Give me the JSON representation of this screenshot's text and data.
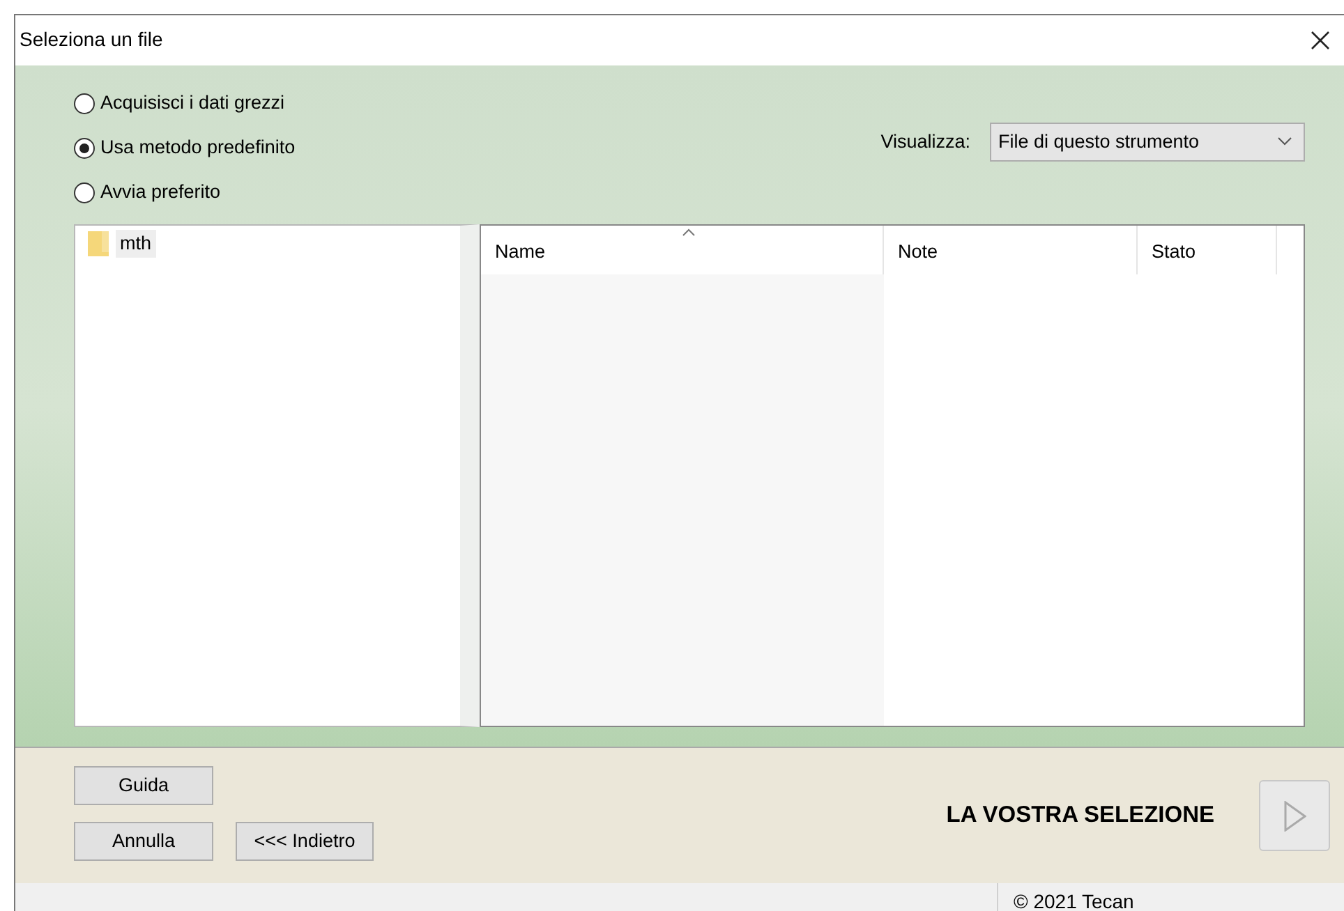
{
  "window": {
    "title": "Seleziona un file"
  },
  "source_options": [
    {
      "label": "Acquisisci i dati grezzi",
      "selected": false
    },
    {
      "label": "Usa metodo predefinito",
      "selected": true
    },
    {
      "label": "Avvia preferito",
      "selected": false
    }
  ],
  "view_filter": {
    "label": "Visualizza:",
    "value": "File di questo strumento"
  },
  "folder_tree": [
    {
      "label": "mth",
      "selected": true
    }
  ],
  "file_list": {
    "columns": [
      {
        "label": "Name",
        "sorted": true
      },
      {
        "label": "Note",
        "sorted": false
      },
      {
        "label": "Stato",
        "sorted": false
      }
    ]
  },
  "buttons": {
    "help": "Guida",
    "cancel": "Annulla",
    "back": "<<< Indietro"
  },
  "selection_label": "LA VOSTRA SELEZIONE",
  "next_button": {
    "disabled": true
  },
  "status_bar": {
    "copyright": "© 2021 Tecan"
  }
}
